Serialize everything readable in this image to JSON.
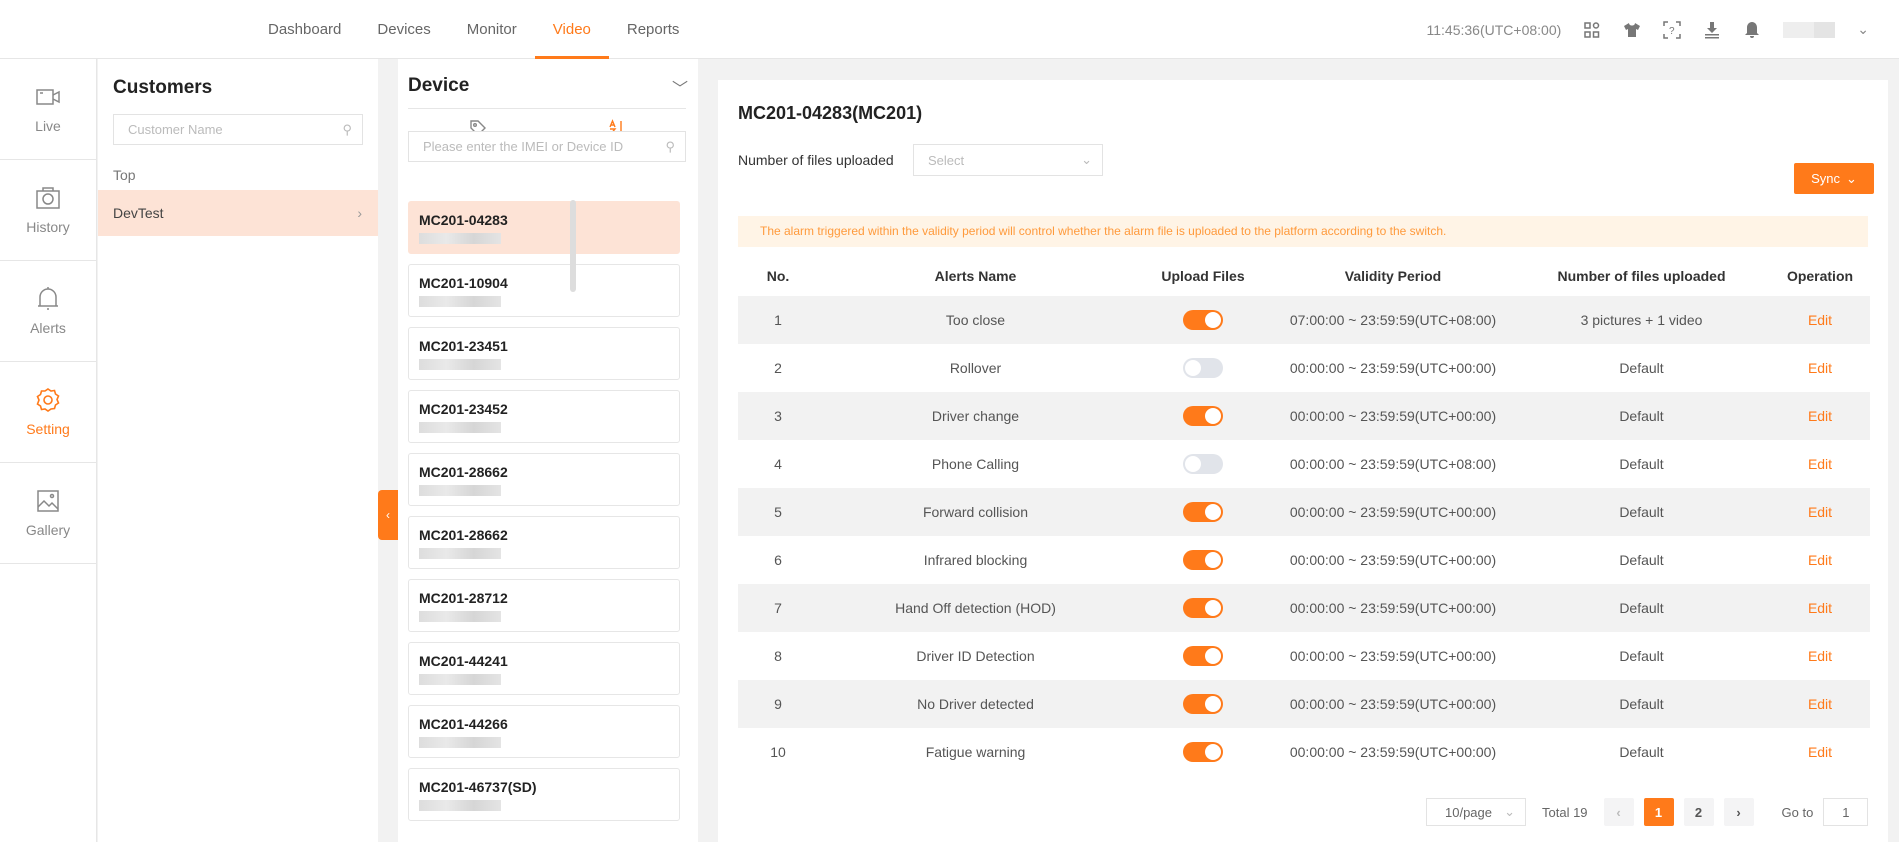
{
  "nav": {
    "items": [
      "Dashboard",
      "Devices",
      "Monitor",
      "Video",
      "Reports"
    ],
    "active": 3,
    "time": "11:45:36(UTC+08:00)"
  },
  "sidebar": {
    "items": [
      "Live",
      "History",
      "Alerts",
      "Setting",
      "Gallery"
    ]
  },
  "customers": {
    "title": "Customers",
    "search_placeholder": "Customer Name",
    "top_label": "Top",
    "selected": "DevTest"
  },
  "device": {
    "title": "Device",
    "search_placeholder": "Please enter the IMEI or Device ID",
    "items": [
      "MC201-04283",
      "MC201-10904",
      "MC201-23451",
      "MC201-23452",
      "MC201-28662",
      "MC201-28662",
      "MC201-28712",
      "MC201-44241",
      "MC201-44266",
      "MC201-46737(SD)"
    ]
  },
  "main": {
    "title": "MC201-04283(MC201)",
    "filter_label": "Number of files uploaded",
    "filter_placeholder": "Select",
    "sync_label": "Sync",
    "notice": "The alarm triggered within the validity period will control whether the alarm file is uploaded to the platform according to the switch.",
    "columns": [
      "No.",
      "Alerts Name",
      "Upload Files",
      "Validity Period",
      "Number of files uploaded",
      "Operation"
    ],
    "rows": [
      {
        "no": "1",
        "name": "Too close",
        "upload": true,
        "period": "07:00:00 ~ 23:59:59(UTC+08:00)",
        "files": "3 pictures + 1 video",
        "op": "Edit"
      },
      {
        "no": "2",
        "name": "Rollover",
        "upload": false,
        "period": "00:00:00 ~ 23:59:59(UTC+00:00)",
        "files": "Default",
        "op": "Edit"
      },
      {
        "no": "3",
        "name": "Driver change",
        "upload": true,
        "period": "00:00:00 ~ 23:59:59(UTC+00:00)",
        "files": "Default",
        "op": "Edit"
      },
      {
        "no": "4",
        "name": "Phone Calling",
        "upload": false,
        "period": "00:00:00 ~ 23:59:59(UTC+08:00)",
        "files": "Default",
        "op": "Edit"
      },
      {
        "no": "5",
        "name": "Forward collision",
        "upload": true,
        "period": "00:00:00 ~ 23:59:59(UTC+00:00)",
        "files": "Default",
        "op": "Edit"
      },
      {
        "no": "6",
        "name": "Infrared blocking",
        "upload": true,
        "period": "00:00:00 ~ 23:59:59(UTC+00:00)",
        "files": "Default",
        "op": "Edit"
      },
      {
        "no": "7",
        "name": "Hand Off detection (HOD)",
        "upload": true,
        "period": "00:00:00 ~ 23:59:59(UTC+00:00)",
        "files": "Default",
        "op": "Edit"
      },
      {
        "no": "8",
        "name": "Driver ID Detection",
        "upload": true,
        "period": "00:00:00 ~ 23:59:59(UTC+00:00)",
        "files": "Default",
        "op": "Edit"
      },
      {
        "no": "9",
        "name": "No Driver detected",
        "upload": true,
        "period": "00:00:00 ~ 23:59:59(UTC+00:00)",
        "files": "Default",
        "op": "Edit"
      },
      {
        "no": "10",
        "name": "Fatigue warning",
        "upload": true,
        "period": "00:00:00 ~ 23:59:59(UTC+00:00)",
        "files": "Default",
        "op": "Edit"
      }
    ]
  },
  "pagination": {
    "page_size": "10/page",
    "total": "Total 19",
    "pages": [
      "1",
      "2"
    ],
    "current": "1",
    "goto_label": "Go to",
    "goto_value": "1"
  },
  "colors": {
    "accent": "#ff7a1a",
    "selected_bg": "#fde3d6"
  }
}
